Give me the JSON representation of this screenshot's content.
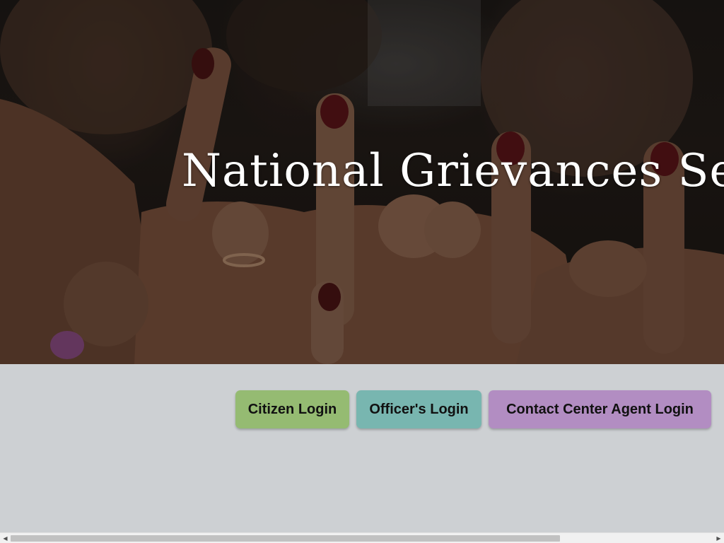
{
  "hero": {
    "title": "National Grievances Service"
  },
  "buttons": {
    "citizen": {
      "label": "Citizen Login",
      "color": "#95bb72"
    },
    "officer": {
      "label": "Officer's Login",
      "color": "#78b6b0"
    },
    "agent": {
      "label": "Contact Center Agent Login",
      "color": "#b28dc2"
    }
  },
  "scrollbar": {
    "left_arrow": "◀",
    "right_arrow": "▶"
  }
}
